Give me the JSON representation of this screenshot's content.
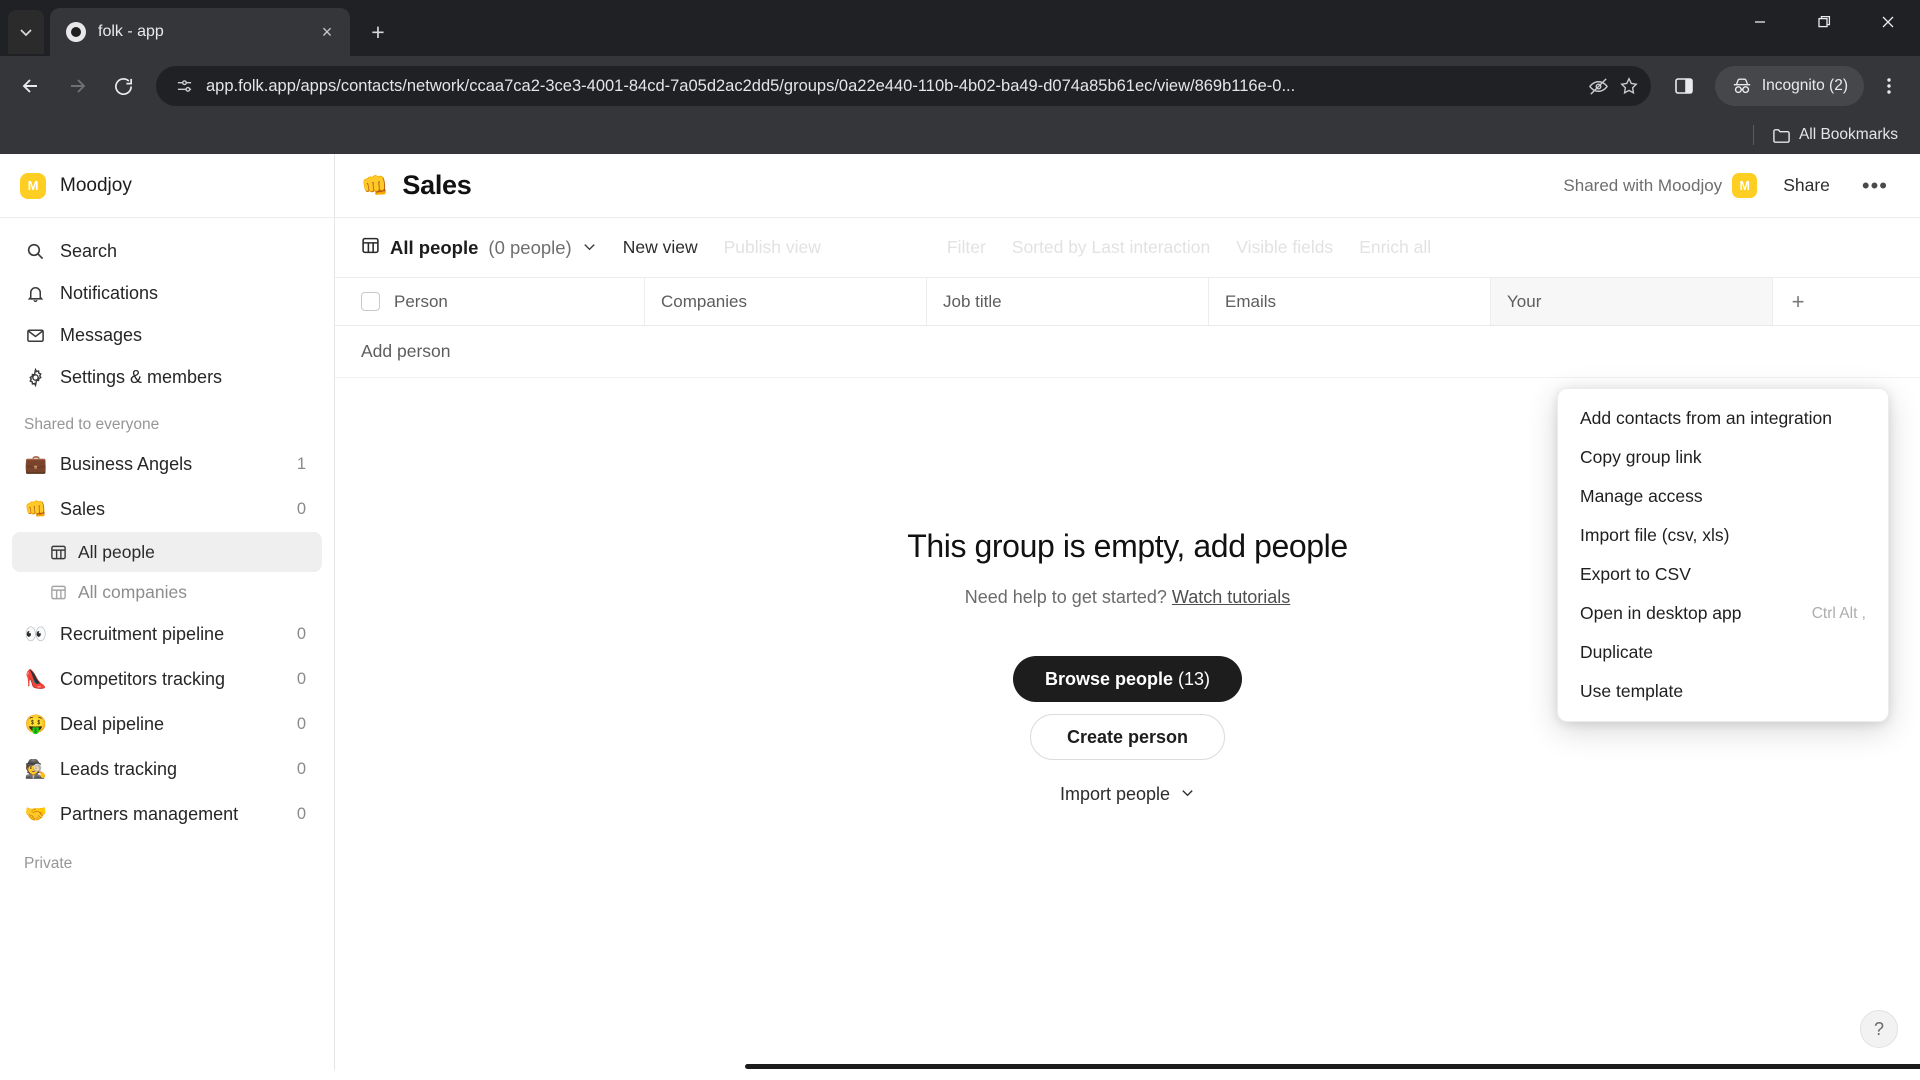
{
  "browser": {
    "tab": {
      "title": "folk - app",
      "favicon": "folk-favicon",
      "close": "×"
    },
    "new_tab_label": "+",
    "tab_search_icon": "chevron-down-icon",
    "window": {
      "minimize": "—",
      "maximize": "❐",
      "close": "✕"
    },
    "nav": {
      "back": "←",
      "forward": "→",
      "reload": "↻"
    },
    "url": "app.folk.app/apps/contacts/network/ccaa7ca2-3ce3-4001-84cd-7a05d2ac2dd5/groups/0a22e440-110b-4b02-ba49-d074a85b61ec/view/869b116e-0...",
    "omnibox_icons": {
      "site_info": "tune-icon",
      "tracking": "eye-slash-icon",
      "bookmark": "star-icon"
    },
    "side_panel_icon": "side-panel-icon",
    "incognito_label": "Incognito (2)",
    "menu_icon": "three-dots-vertical-icon",
    "bookmarks": {
      "all_bookmarks": "All Bookmarks"
    }
  },
  "sidebar": {
    "workspace": {
      "name": "Moodjoy",
      "initial": "M",
      "color": "#FFCE22"
    },
    "nav": [
      {
        "label": "Search",
        "icon": "search-icon"
      },
      {
        "label": "Notifications",
        "icon": "bell-icon"
      },
      {
        "label": "Messages",
        "icon": "envelope-icon"
      },
      {
        "label": "Settings & members",
        "icon": "gear-icon"
      }
    ],
    "shared_label": "Shared to everyone",
    "groups": [
      {
        "label": "Business Angels",
        "emoji": "💼",
        "count": "1"
      },
      {
        "label": "Sales",
        "emoji": "👊",
        "count": "0",
        "active": true
      },
      {
        "label": "Recruitment pipeline",
        "emoji": "👀",
        "count": "0"
      },
      {
        "label": "Competitors tracking",
        "emoji": "👠",
        "count": "0"
      },
      {
        "label": "Deal pipeline",
        "emoji": "🤑",
        "count": "0"
      },
      {
        "label": "Leads tracking",
        "emoji": "🕵️",
        "count": "0"
      },
      {
        "label": "Partners management",
        "emoji": "🤝",
        "count": "0"
      }
    ],
    "subitems": [
      {
        "label": "All people",
        "icon": "table-icon",
        "active": true
      },
      {
        "label": "All companies",
        "icon": "table-icon",
        "active": false
      }
    ],
    "private_label": "Private"
  },
  "header": {
    "emoji": "👊",
    "title": "Sales",
    "shared_with": "Shared with Moodjoy",
    "shared_initial": "M",
    "share_label": "Share",
    "more_label": "•••"
  },
  "view_toolbar": {
    "view_icon": "table-icon",
    "view_name": "All people",
    "view_count": "(0 people)",
    "chevron": "chevron-down-icon",
    "new_view": "New view",
    "publish_view": "Publish view",
    "filter": "Filter",
    "sorted_by": "Sorted by Last interaction",
    "visible_fields": "Visible fields",
    "enrich_all": "Enrich all"
  },
  "table": {
    "columns": [
      "Person",
      "Companies",
      "Job title",
      "Emails",
      "Your"
    ],
    "add_column": "+",
    "add_person": "Add person",
    "rows": []
  },
  "empty_state": {
    "title": "This group is empty, add people",
    "subtitle": "Need help to get started?",
    "link": "Watch tutorials",
    "browse_label": "Browse people",
    "browse_count": "(13)",
    "create_label": "Create person",
    "import_label": "Import people",
    "import_chevron": "chevron-down-icon"
  },
  "context_menu": {
    "items": [
      {
        "label": "Add contacts from an integration",
        "shortcut": ""
      },
      {
        "label": "Copy group link",
        "shortcut": ""
      },
      {
        "label": "Manage access",
        "shortcut": ""
      },
      {
        "label": "Import file (csv, xls)",
        "shortcut": ""
      },
      {
        "label": "Export to CSV",
        "shortcut": ""
      },
      {
        "label": "Open in desktop app",
        "shortcut": "Ctrl Alt ,"
      },
      {
        "label": "Duplicate",
        "shortcut": ""
      },
      {
        "label": "Use template",
        "shortcut": ""
      }
    ]
  },
  "help": {
    "label": "?"
  }
}
